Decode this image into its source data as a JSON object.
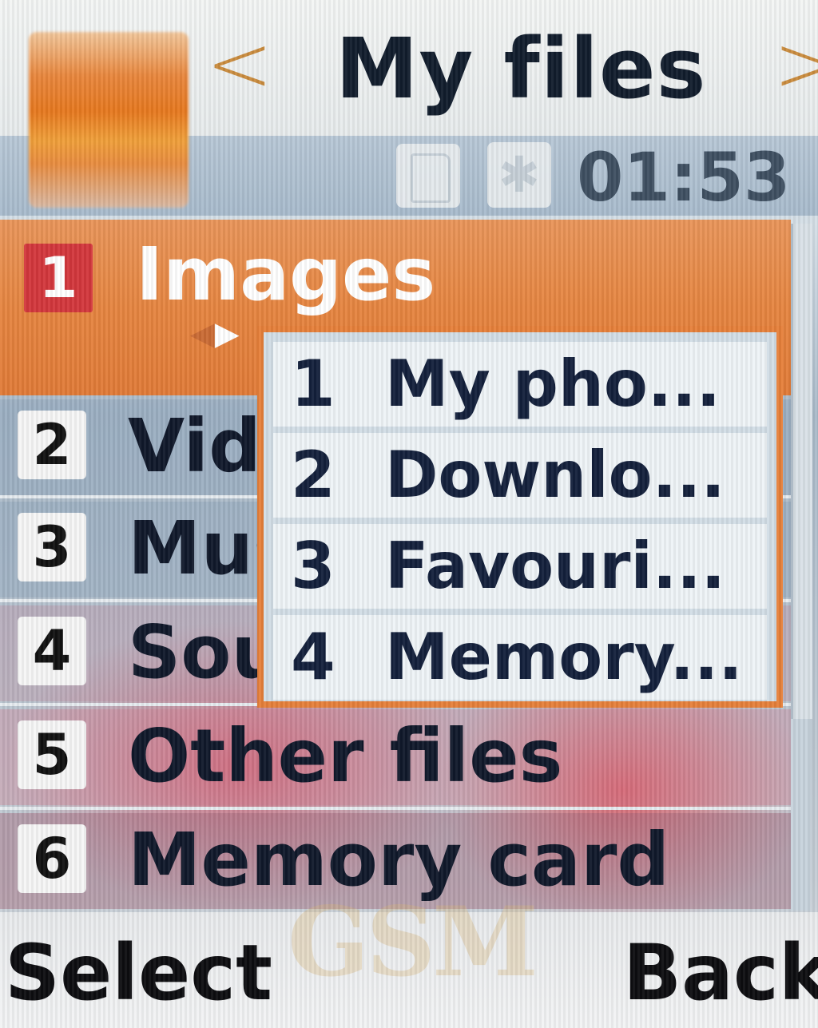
{
  "header": {
    "title": "My files",
    "prev_arrow": "<",
    "next_arrow": ">"
  },
  "status": {
    "clock": "01:53",
    "icons": [
      "memory-card-icon",
      "bluetooth-icon"
    ]
  },
  "menu": {
    "items": [
      {
        "number": "1",
        "label": "Images",
        "selected": true
      },
      {
        "number": "2",
        "label": "Vide"
      },
      {
        "number": "3",
        "label": "Mus"
      },
      {
        "number": "4",
        "label": "Sou"
      },
      {
        "number": "5",
        "label": "Other files"
      },
      {
        "number": "6",
        "label": "Memory card"
      }
    ]
  },
  "submenu": {
    "items": [
      {
        "number": "1",
        "label": "My pho..."
      },
      {
        "number": "2",
        "label": "Downlo..."
      },
      {
        "number": "3",
        "label": "Favouri..."
      },
      {
        "number": "4",
        "label": "Memory..."
      }
    ]
  },
  "softkeys": {
    "left": "Select",
    "right": "Back"
  },
  "watermark": "GSM"
}
